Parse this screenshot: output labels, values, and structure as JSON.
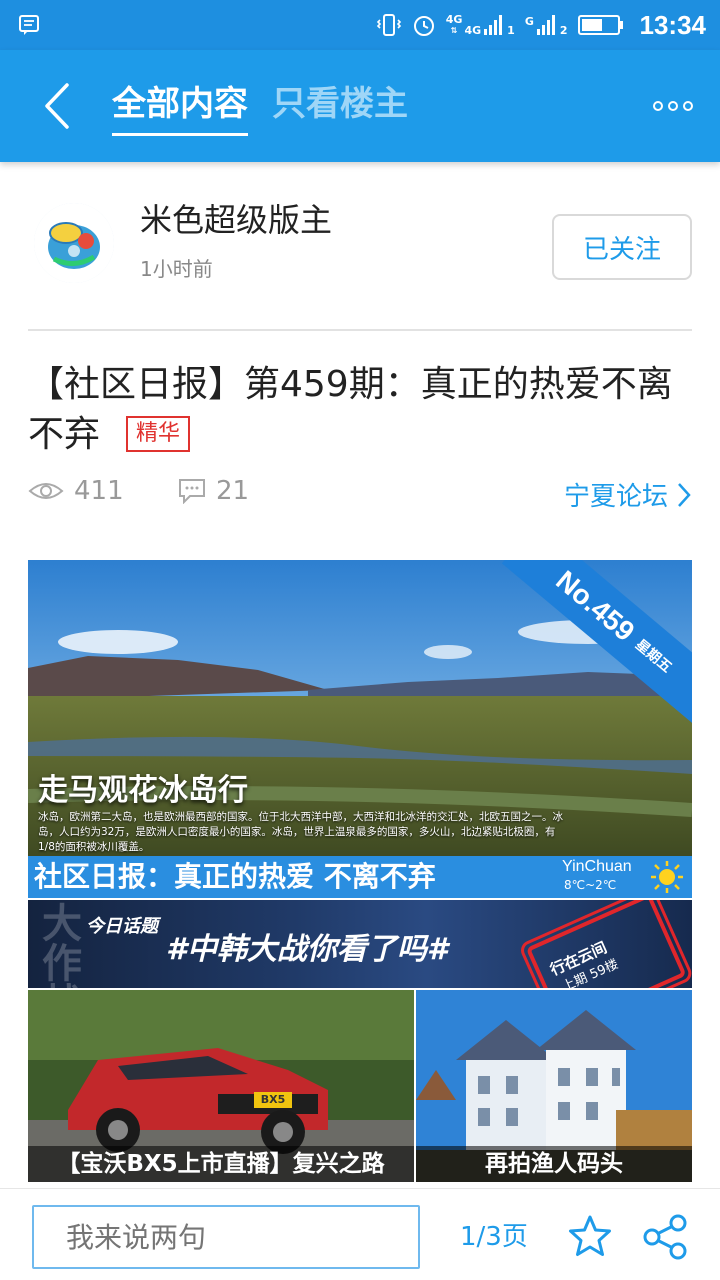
{
  "status_bar": {
    "network_1": "4G",
    "network_2": "4G",
    "sim1_label": "1",
    "sim2_label": "2",
    "network_g": "G",
    "time": "13:34"
  },
  "nav": {
    "tab_all": "全部内容",
    "tab_op_only": "只看楼主"
  },
  "author": {
    "name": "米色超级版主",
    "time": "1小时前",
    "follow_label": "已关注"
  },
  "post": {
    "title": "【社区日报】第459期：真正的热爱不离不弃",
    "badge": "精华",
    "views": "411",
    "comments": "21",
    "forum": "宁夏论坛"
  },
  "banner": {
    "ribbon_number": "No.459",
    "ribbon_day": "星期五",
    "hero_title": "走马观花冰岛行",
    "hero_desc": "冰岛，欧洲第二大岛，也是欧洲最西部的国家。位于北大西洋中部，大西洋和北冰洋的交汇处，北欧五国之一。冰岛，人口约为32万，是欧洲人口密度最小的国家。冰岛，世界上温泉最多的国家，多火山，北边紧贴北极圈，有1/8的面积被冰川覆盖。",
    "strip_title": "社区日报：真正的热爱 不离不弃",
    "weather_city": "YinChuan",
    "weather_temp": "8℃~2℃",
    "topic_big": "大作战",
    "topic_label": "今日话题",
    "topic_text": "#中韩大战你看了吗#",
    "stamp_line1": "行在云间",
    "stamp_line2": "上期 59楼",
    "tile_car_caption": "【宝沃BX5上市直播】复兴之路",
    "tile_car_plate": "BX5",
    "tile_house_caption": "再拍渔人码头"
  },
  "bottom": {
    "input_placeholder": "我来说两句",
    "pager": "1/3页"
  },
  "colors": {
    "primary": "#1e9be9",
    "status_bar": "#1e8fe0",
    "badge_red": "#e0322f"
  }
}
